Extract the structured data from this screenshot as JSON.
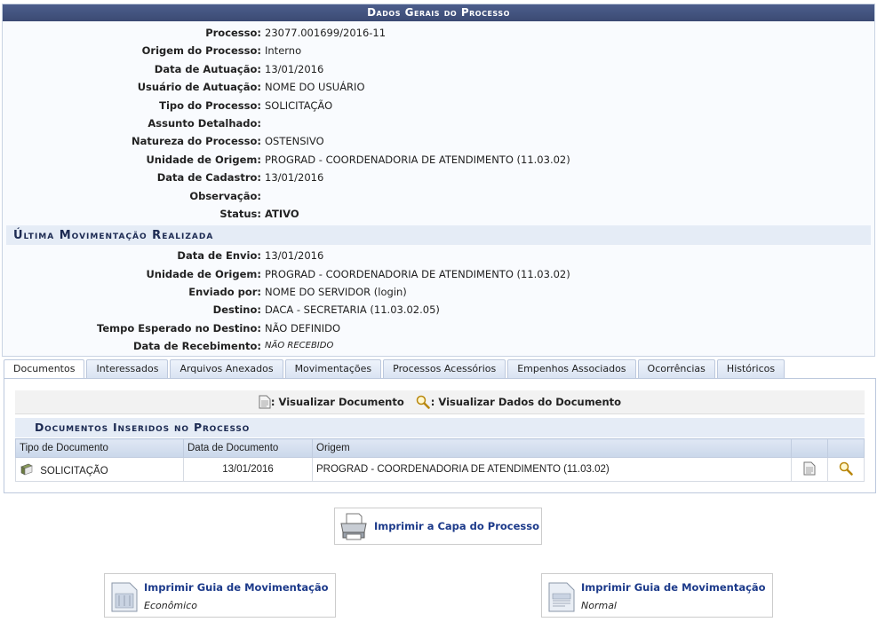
{
  "panel": {
    "title": "Dados Gerais do Processo"
  },
  "general": [
    {
      "label": "Processo:",
      "value": "23077.001699/2016-11"
    },
    {
      "label": "Origem do Processo:",
      "value": "Interno"
    },
    {
      "label": "Data de Autuação:",
      "value": "13/01/2016"
    },
    {
      "label": "Usuário de Autuação:",
      "value": "NOME DO USUÁRIO"
    },
    {
      "label": "Tipo do Processo:",
      "value": "SOLICITAÇÃO"
    },
    {
      "label": "Assunto Detalhado:",
      "value": ""
    },
    {
      "label": "Natureza do Processo:",
      "value": "OSTENSIVO"
    },
    {
      "label": "Unidade de Origem:",
      "value": "PROGRAD - COORDENADORIA DE ATENDIMENTO (11.03.02)"
    },
    {
      "label": "Data de Cadastro:",
      "value": "13/01/2016"
    },
    {
      "label": "Observação:",
      "value": ""
    },
    {
      "label": "Status:",
      "value": "ATIVO"
    }
  ],
  "last_move": {
    "title": "Última Movimentação Realizada",
    "rows": [
      {
        "label": "Data de Envio:",
        "value": "13/01/2016"
      },
      {
        "label": "Unidade de Origem:",
        "value": "PROGRAD - COORDENADORIA DE ATENDIMENTO (11.03.02)"
      },
      {
        "label": "Enviado por:",
        "value": "NOME DO SERVIDOR (login)"
      },
      {
        "label": "Destino:",
        "value": "DACA - SECRETARIA (11.03.02.05)"
      },
      {
        "label": "Tempo Esperado no Destino:",
        "value": "NÃO DEFINIDO"
      },
      {
        "label": "Data de Recebimento:",
        "value": "NÃO RECEBIDO"
      }
    ]
  },
  "tabs": [
    "Documentos",
    "Interessados",
    "Arquivos Anexados",
    "Movimentações",
    "Processos Acessórios",
    "Empenhos Associados",
    "Ocorrências",
    "Históricos"
  ],
  "legend": {
    "view_doc": ": Visualizar Documento",
    "view_data": ": Visualizar Dados do Documento"
  },
  "docs": {
    "caption": "Documentos Inseridos no Processo",
    "headers": [
      "Tipo de Documento",
      "Data de Documento",
      "Origem"
    ],
    "rows": [
      {
        "tipo": "SOLICITAÇÃO",
        "data": "13/01/2016",
        "origem": "PROGRAD - COORDENADORIA DE ATENDIMENTO (11.03.02)"
      }
    ]
  },
  "actions": {
    "print_cover": "Imprimir a Capa do Processo",
    "guia_title": "Imprimir Guia de Movimentação",
    "guia_eco": "Econômico",
    "guia_normal": "Normal"
  },
  "colors": {
    "header": "#3f4f7b",
    "status_ok": "#2a8a1e",
    "alert": "#d01010",
    "link": "#1c3a8a"
  }
}
